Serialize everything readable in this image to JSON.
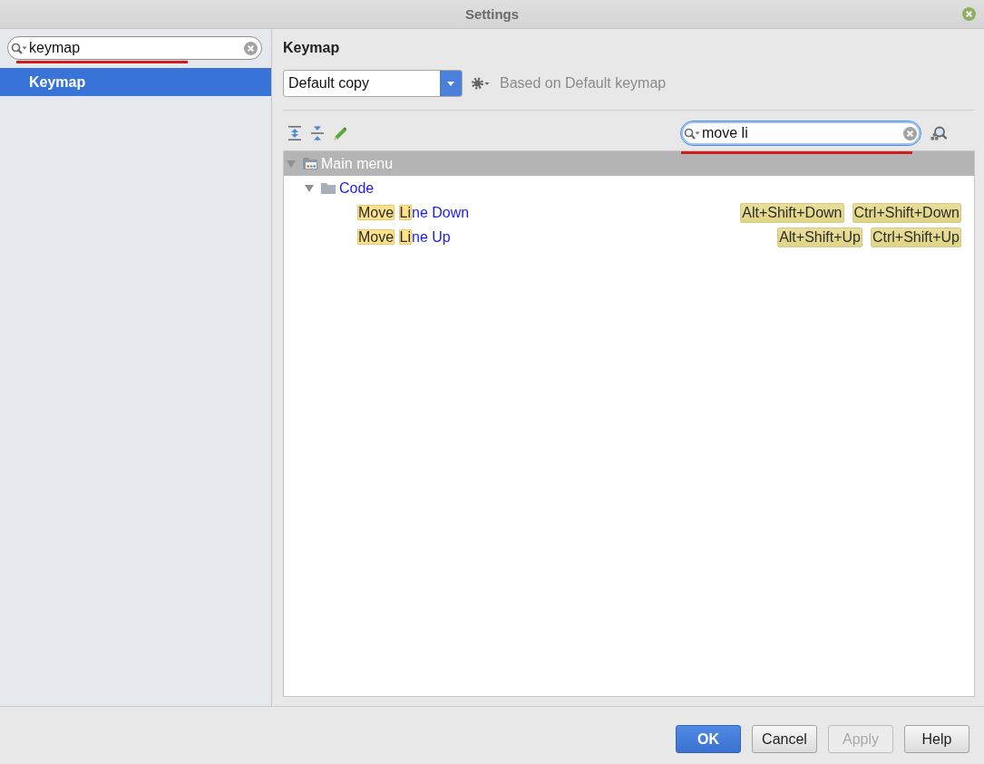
{
  "window": {
    "title": "Settings"
  },
  "sidebar": {
    "search": {
      "value": "keymap",
      "focused": false,
      "spelling_error": true
    },
    "items": [
      {
        "label": "Keymap",
        "selected": true
      }
    ]
  },
  "keymap": {
    "title": "Keymap",
    "scheme": {
      "value": "Default copy"
    },
    "based_on": "Based on Default keymap",
    "search": {
      "value": "move li",
      "focused": true,
      "spelling_error": true
    },
    "tree": [
      {
        "kind": "menu",
        "label": "Main menu",
        "expanded": true,
        "selected": true,
        "children": [
          {
            "kind": "folder",
            "label": "Code",
            "expanded": true,
            "selected": false,
            "children": [
              {
                "kind": "action",
                "selected": false,
                "words": [
                  {
                    "segments": [
                      {
                        "text": "Move",
                        "match": true
                      }
                    ]
                  },
                  {
                    "segments": [
                      {
                        "text": "Li",
                        "match": true
                      },
                      {
                        "text": "ne",
                        "match": false
                      }
                    ]
                  },
                  {
                    "segments": [
                      {
                        "text": "Down",
                        "match": false
                      }
                    ]
                  }
                ],
                "shortcuts": [
                  "Alt+Shift+Down",
                  "Ctrl+Shift+Down"
                ]
              },
              {
                "kind": "action",
                "selected": false,
                "words": [
                  {
                    "segments": [
                      {
                        "text": "Move",
                        "match": true
                      }
                    ]
                  },
                  {
                    "segments": [
                      {
                        "text": "Li",
                        "match": true
                      },
                      {
                        "text": "ne",
                        "match": false
                      }
                    ]
                  },
                  {
                    "segments": [
                      {
                        "text": "Up",
                        "match": false
                      }
                    ]
                  }
                ],
                "shortcuts": [
                  "Alt+Shift+Up",
                  "Ctrl+Shift+Up"
                ]
              }
            ]
          }
        ]
      }
    ]
  },
  "buttons": [
    {
      "label": "OK",
      "kind": "default",
      "disabled": false
    },
    {
      "label": "Cancel",
      "kind": "normal",
      "disabled": false
    },
    {
      "label": "Apply",
      "kind": "normal",
      "disabled": true
    },
    {
      "label": "Help",
      "kind": "normal",
      "disabled": false
    }
  ]
}
